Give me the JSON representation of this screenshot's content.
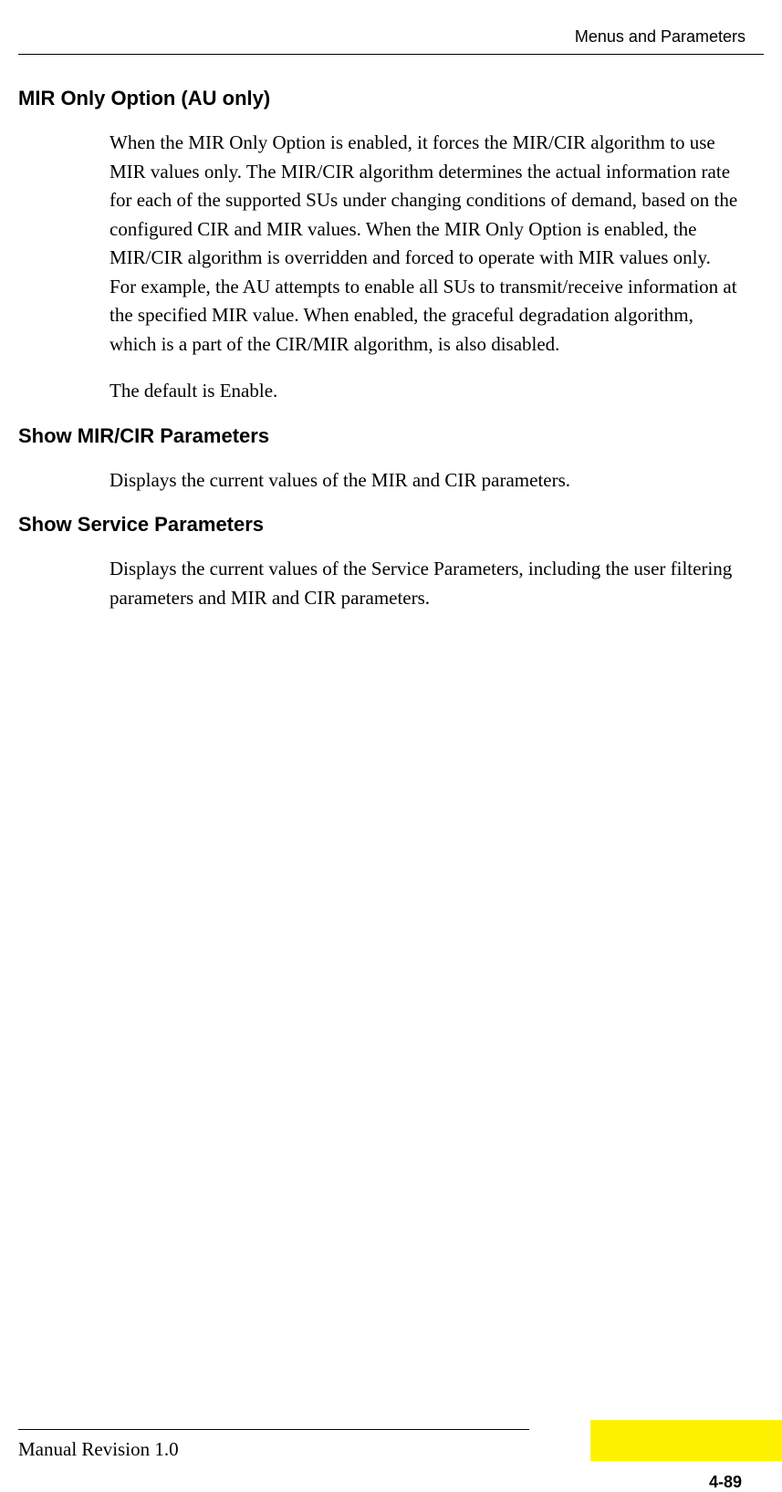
{
  "header": {
    "title": "Menus and Parameters"
  },
  "sections": [
    {
      "heading": "MIR Only Option (AU only)",
      "paragraphs": [
        "When the MIR Only Option is enabled, it forces the MIR/CIR algorithm to use MIR values only. The MIR/CIR algorithm determines the actual information rate for each of the supported SUs under changing conditions of demand, based on the configured CIR and MIR values. When the MIR Only Option is enabled, the MIR/CIR algorithm is overridden and forced to operate with MIR values only. For example, the AU attempts to enable all SUs to transmit/receive information at the specified MIR value. When enabled, the graceful degradation algorithm, which is a part of the CIR/MIR algorithm, is also disabled.",
        "The default is Enable."
      ]
    },
    {
      "heading": "Show MIR/CIR Parameters",
      "paragraphs": [
        "Displays the current values of the MIR and CIR parameters."
      ]
    },
    {
      "heading": "Show Service Parameters",
      "paragraphs": [
        "Displays the current values of the Service Parameters, including the user filtering parameters and MIR and CIR parameters."
      ]
    }
  ],
  "footer": {
    "revision": "Manual Revision 1.0",
    "page_number": "4-89"
  }
}
